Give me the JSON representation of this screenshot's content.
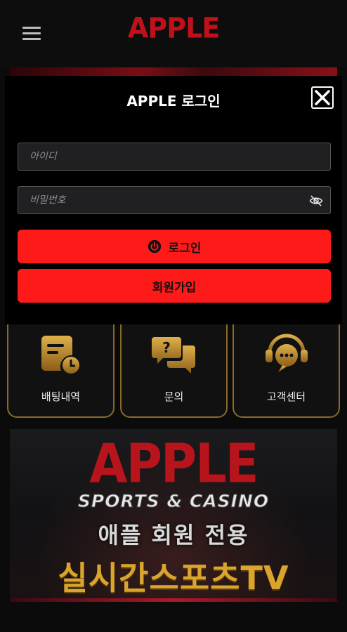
{
  "header": {
    "logo": "APPLE",
    "menu_icon": "hamburger-icon"
  },
  "modal": {
    "title": "APPLE 로그인",
    "username_placeholder": "아이디",
    "password_placeholder": "비밀번호",
    "login_label": "로그인",
    "signup_label": "회원가입"
  },
  "quick_menu": [
    {
      "label": "배팅내역",
      "icon": "betting-history-icon"
    },
    {
      "label": "문의",
      "icon": "inquiry-icon"
    },
    {
      "label": "고객센터",
      "icon": "customer-center-icon"
    }
  ],
  "promo": {
    "title": "APPLE",
    "subtitle": "SPORTS & CASINO",
    "member_text": "애플 회원 전용",
    "tv_text": "실시간스포츠TV"
  },
  "colors": {
    "accent_red": "#ff1a1a",
    "logo_red": "#c0111a",
    "gold": "#d9a52c"
  }
}
